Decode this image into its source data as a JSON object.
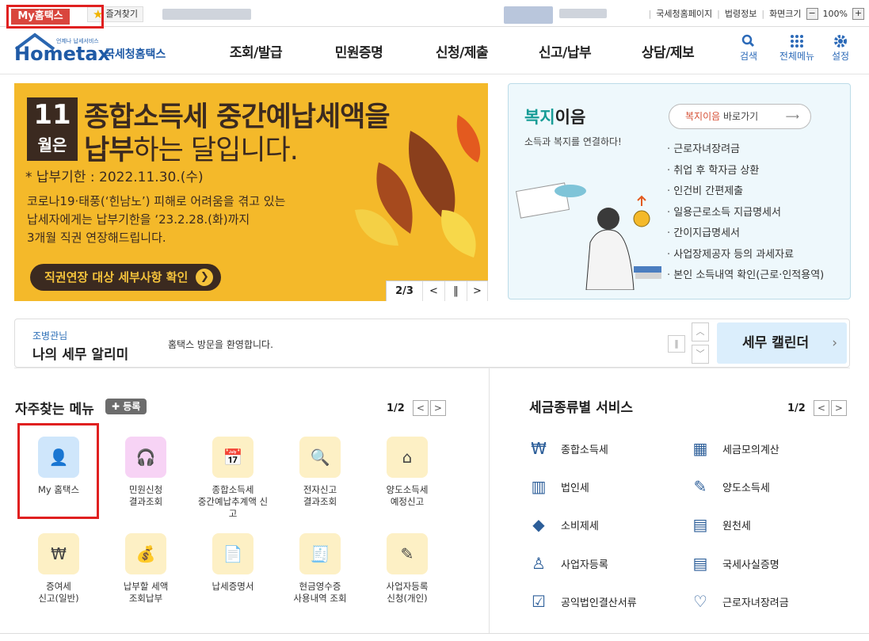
{
  "topbar": {
    "my_hometax": "My홈택스",
    "favorites": "즐겨찾기",
    "links": [
      "국세청홈페이지",
      "법령정보",
      "화면크기"
    ],
    "zoom_minus": "−",
    "zoom": "100%",
    "zoom_plus": "+"
  },
  "header": {
    "logo_small": "언제나 납세서비스",
    "logo_text": "Hometax",
    "logo_sub": "국세청홈택스",
    "nav": [
      "조회/발급",
      "민원증명",
      "신청/제출",
      "신고/납부",
      "상담/제보"
    ],
    "icons": [
      {
        "label": "검색",
        "icon": "search-icon"
      },
      {
        "label": "전체메뉴",
        "icon": "grid-menu-icon"
      },
      {
        "label": "설정",
        "icon": "gear-icon"
      }
    ]
  },
  "banner": {
    "month_num": "11",
    "month_word": "월은",
    "title_line1": "종합소득세 중간예납세액을",
    "title_line2_bold": "납부",
    "title_line2_rest": "하는 달입니다.",
    "due": "납부기한 : 2022.11.30.(수)",
    "desc_lines": [
      "코로나19·태풍(‘힌남노’) 피해로 어려움을 겪고 있는",
      "납세자에게는 납부기한을 ‘23.2.28.(화)까지",
      "3개월 직권 연장해드립니다."
    ],
    "button": "직권연장 대상 세부사항 확인",
    "page": "2/3",
    "colors": {
      "bg": "#f4b92a",
      "dark": "#3b2a20"
    }
  },
  "welfare": {
    "title_green": "복지",
    "title_rest": "이음",
    "subtitle": "소득과 복지를 연결하다!",
    "go_green": "복지이음",
    "go_rest": "바로가기",
    "items": [
      "근로자녀장려금",
      "취업 후 학자금 상환",
      "인건비 간편제출",
      "일용근로소득 지급명세서",
      "간이지급명세서",
      "사업장제공자 등의 과세자료",
      "본인 소득내역 확인(근로·인적용역)"
    ]
  },
  "alarm": {
    "user": "조병관님",
    "title": "나의 세무 알리미",
    "message": "홈택스 방문을 환영합니다.",
    "calendar": "세무 캘린더"
  },
  "quick_menu": {
    "title": "자주찾는 메뉴",
    "register": "등록",
    "page": "1/2",
    "items": [
      {
        "label": "My 홈택스",
        "icon": "user-icon"
      },
      {
        "label": "민원신청\n결과조회",
        "icon": "headset-icon"
      },
      {
        "label": "종합소득세\n중간예납추계액 신\n고",
        "icon": "calendar-pen-icon"
      },
      {
        "label": "전자신고\n결과조회",
        "icon": "search-doc-icon"
      },
      {
        "label": "양도소득세\n예정신고",
        "icon": "house-icon"
      },
      {
        "label": "증여세\n신고(일반)",
        "icon": "gift-won-icon"
      },
      {
        "label": "납부할 세액\n조회납부",
        "icon": "money-bag-icon"
      },
      {
        "label": "납세증명서",
        "icon": "certificate-icon"
      },
      {
        "label": "현금영수증\n사용내역 조회",
        "icon": "receipt-icon"
      },
      {
        "label": "사업자등록\n신청(개인)",
        "icon": "user-pen-icon"
      }
    ]
  },
  "tax_services": {
    "title": "세금종류별 서비스",
    "page": "1/2",
    "items": [
      {
        "label": "종합소득세",
        "icon": "won-car-icon"
      },
      {
        "label": "세금모의계산",
        "icon": "calculator-icon"
      },
      {
        "label": "법인세",
        "icon": "building-icon"
      },
      {
        "label": "양도소득세",
        "icon": "doc-pen-icon"
      },
      {
        "label": "소비제세",
        "icon": "diamond-icon"
      },
      {
        "label": "원천세",
        "icon": "slip-icon"
      },
      {
        "label": "사업자등록",
        "icon": "person-icon"
      },
      {
        "label": "국세사실증명",
        "icon": "document-icon"
      },
      {
        "label": "공익법인결산서류",
        "icon": "clipboard-check-icon"
      },
      {
        "label": "근로자녀장려금",
        "icon": "heart-hands-icon"
      }
    ]
  }
}
